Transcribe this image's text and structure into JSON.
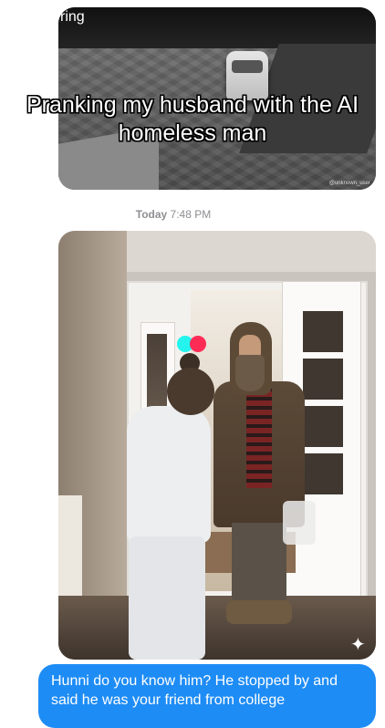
{
  "video_overlay": {
    "caption": "Pranking my husband with the AI homeless man"
  },
  "camera_image": {
    "logo_text": "ring",
    "watermark": "@unknown_user"
  },
  "conversation": {
    "timestamp_day": "Today",
    "timestamp_time": "7:48 PM",
    "message_text": "Hunni do you know him? He stopped by and said he was your friend from college"
  },
  "colors": {
    "bubble_blue": "#1e8cf5",
    "tiktok_cyan": "#25f4ee",
    "tiktok_red": "#fe2c55"
  }
}
